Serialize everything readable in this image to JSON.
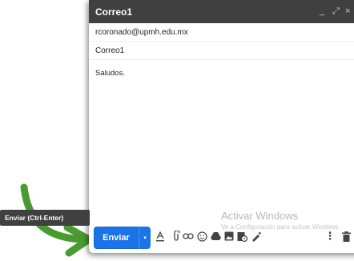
{
  "window": {
    "title": "Correo1",
    "minimize": "_",
    "expand": "⤢",
    "close": "×"
  },
  "fields": {
    "to": "rcoronado@upmh.edu.mx",
    "subject": "Correo1"
  },
  "body": "Saludos.",
  "tooltip": "Enviar (Ctrl-Enter)",
  "toolbar": {
    "send_label": "Enviar",
    "send_more": "▾",
    "more_options": "⋮"
  },
  "watermark": {
    "title": "Activar Windows",
    "subtitle": "Ve a Configuración para activar Windows."
  },
  "colors": {
    "send_button": "#1a73e8",
    "titlebar": "#404040",
    "arrow": "#4a9b2f"
  },
  "icons": [
    "formatting-icon",
    "attach-icon",
    "link-icon",
    "emoji-icon",
    "drive-icon",
    "photo-icon",
    "confidential-icon",
    "signature-icon",
    "more-options-icon",
    "trash-icon"
  ]
}
